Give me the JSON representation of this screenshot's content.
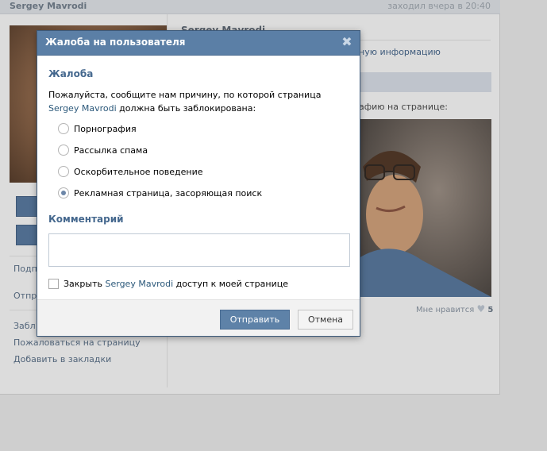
{
  "background": {
    "top_bar": {
      "name": "Sergey Mavrodi",
      "status": "заходил вчера в 20:40"
    },
    "left_links": {
      "partial_1": "Подп",
      "partial_2": "Отпр",
      "partial_3": "Забл",
      "report": "Пожаловаться на страницу",
      "bookmark": "Добавить в закладки"
    },
    "main": {
      "name": "Sergey Mavrodi",
      "info_link_partial": "ную информацию",
      "photo_caption_partial": "афию на странице:",
      "likes_label": "Мне нравится",
      "likes_count": "5"
    }
  },
  "modal": {
    "title": "Жалоба на пользователя",
    "close_glyph": "✖",
    "complaint_heading": "Жалоба",
    "prompt_before": "Пожалуйста, сообщите нам причину, по которой страница ",
    "prompt_user": "Sergey Mavrodi",
    "prompt_after": " должна быть заблокирована:",
    "reasons": [
      {
        "label": "Порнография",
        "checked": false
      },
      {
        "label": "Рассылка спама",
        "checked": false
      },
      {
        "label": "Оскорбительное поведение",
        "checked": false
      },
      {
        "label": "Рекламная страница, засоряющая поиск",
        "checked": true
      }
    ],
    "comment_heading": "Комментарий",
    "comment_value": "",
    "block_before": "Закрыть ",
    "block_user": "Sergey Mavrodi",
    "block_after": " доступ к моей странице",
    "send_label": "Отправить",
    "cancel_label": "Отмена"
  },
  "colors": {
    "modal_header": "#5b7fa6",
    "accent_text": "#45688e",
    "link": "#2b587a",
    "send_button": "#5e82a8"
  }
}
